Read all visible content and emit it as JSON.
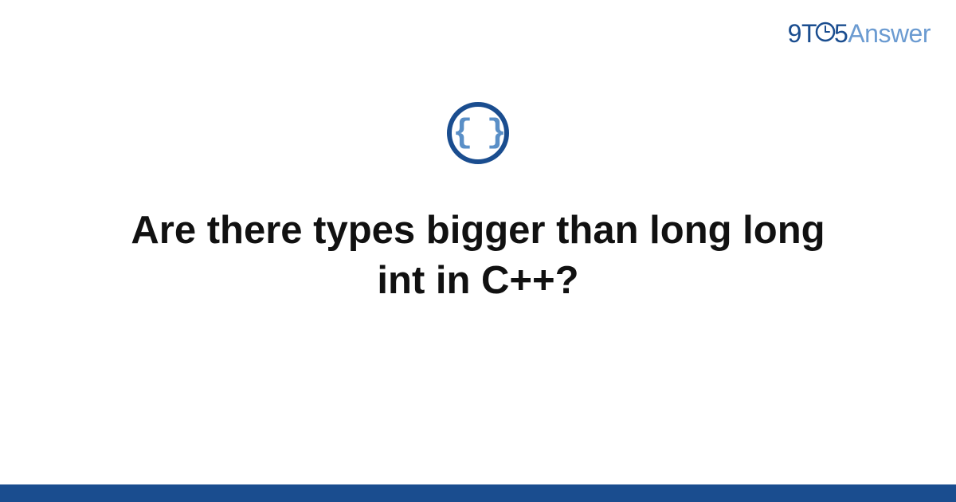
{
  "logo": {
    "part1": "9",
    "part2": "T",
    "part3": "5",
    "part4": "Answer"
  },
  "icon": {
    "symbol": "{ }",
    "name": "code-braces"
  },
  "main": {
    "title": "Are there types bigger than long long int in C++?"
  },
  "colors": {
    "primary": "#1a4d8f",
    "accent": "#5a8fc7",
    "logo_light": "#6b9bd1"
  }
}
